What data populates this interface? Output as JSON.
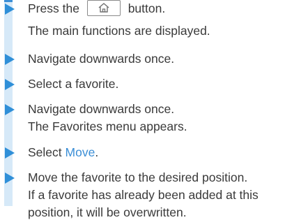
{
  "heading_fragment": "",
  "steps": [
    {
      "lines": [
        "Press the",
        "button.",
        "The main functions are displayed."
      ],
      "button_icon": "home-icon"
    },
    {
      "lines": [
        "Navigate downwards once."
      ]
    },
    {
      "lines": [
        "Select a favorite."
      ]
    },
    {
      "lines": [
        "Navigate downwards once.",
        "The Favorites menu appears."
      ]
    },
    {
      "lines": [
        "Select",
        "Move",
        "."
      ]
    },
    {
      "lines": [
        "Move the favorite to the desired position.",
        "If a favorite has already been added at this",
        "position, it will be overwritten."
      ]
    }
  ],
  "colors": {
    "accent": "#3b8ed6",
    "arrow": "#2f8fd8",
    "side_bar": "#d6e9f8",
    "text": "#3a3a3a"
  }
}
